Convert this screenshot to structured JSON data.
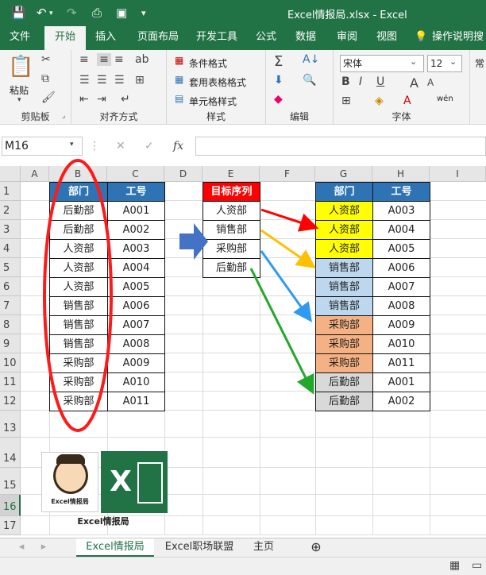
{
  "window": {
    "title": "Excel情报局.xlsx  -  Excel",
    "accent": "#217346"
  },
  "ribbon_tabs": [
    "文件",
    "开始",
    "插入",
    "页面布局",
    "开发工具",
    "公式",
    "数据",
    "审阅",
    "视图"
  ],
  "tell_me": "操作说明搜",
  "ribbon": {
    "clipboard": {
      "paste": "粘贴",
      "label": "剪贴板"
    },
    "alignment": {
      "label": "对齐方式"
    },
    "styles": {
      "cond": "条件格式",
      "table": "套用表格格式",
      "cell": "单元格样式",
      "label": "样式"
    },
    "editing": {
      "label": "编辑"
    },
    "font": {
      "name": "宋体",
      "size": "12",
      "label": "字体",
      "wen": "wén",
      "bold": "B",
      "italic": "I",
      "underline": "U",
      "A": "A",
      "Abig": "A",
      "Asmall": "A"
    },
    "cutoff": "常"
  },
  "formula_bar": {
    "namebox": "M16",
    "fx": "fx",
    "cancel": "✕",
    "enter": "✓",
    "value": ""
  },
  "columns": [
    "A",
    "B",
    "C",
    "D",
    "E",
    "F",
    "G",
    "H",
    "I"
  ],
  "rows": [
    "1",
    "2",
    "3",
    "4",
    "5",
    "6",
    "7",
    "8",
    "9",
    "10",
    "11",
    "12",
    "13",
    "14",
    "15",
    "16",
    "17"
  ],
  "table_left": {
    "headers": [
      "部门",
      "工号"
    ],
    "rows": [
      [
        "后勤部",
        "A001"
      ],
      [
        "后勤部",
        "A002"
      ],
      [
        "人资部",
        "A003"
      ],
      [
        "人资部",
        "A004"
      ],
      [
        "人资部",
        "A005"
      ],
      [
        "销售部",
        "A006"
      ],
      [
        "销售部",
        "A007"
      ],
      [
        "销售部",
        "A008"
      ],
      [
        "采购部",
        "A009"
      ],
      [
        "采购部",
        "A010"
      ],
      [
        "采购部",
        "A011"
      ]
    ]
  },
  "target_order": {
    "header": "目标序列",
    "items": [
      "人资部",
      "销售部",
      "采购部",
      "后勤部"
    ]
  },
  "table_right": {
    "headers": [
      "部门",
      "工号"
    ],
    "rows": [
      [
        "人资部",
        "A003"
      ],
      [
        "人资部",
        "A004"
      ],
      [
        "人资部",
        "A005"
      ],
      [
        "销售部",
        "A006"
      ],
      [
        "销售部",
        "A007"
      ],
      [
        "销售部",
        "A008"
      ],
      [
        "采购部",
        "A009"
      ],
      [
        "采购部",
        "A010"
      ],
      [
        "采购部",
        "A011"
      ],
      [
        "后勤部",
        "A001"
      ],
      [
        "后勤部",
        "A002"
      ]
    ],
    "colors": {
      "人资部": "#ffff00",
      "销售部": "#bdd7ee",
      "采购部": "#f4b183",
      "后勤部": "#d9d9d9"
    }
  },
  "logo": {
    "caption": "Excel情报局",
    "badge": "Excel情报局",
    "x_letter": "X"
  },
  "sheet_tabs": [
    "Excel情报局",
    "Excel职场联盟",
    "主页"
  ],
  "add_sheet": "⊕"
}
